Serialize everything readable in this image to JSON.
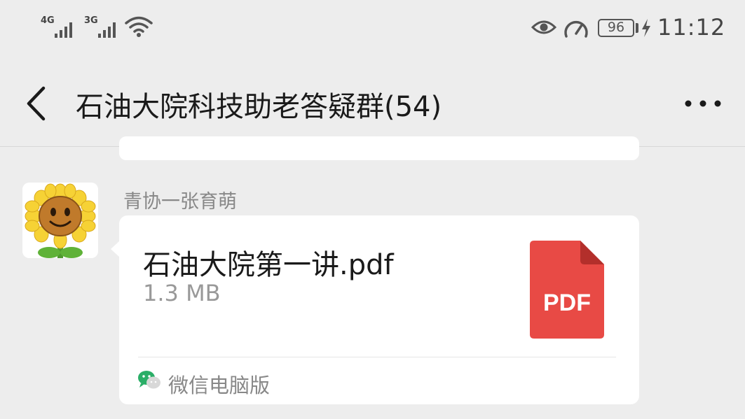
{
  "status_bar": {
    "network1": "4G",
    "network2": "3G",
    "battery_level": "96",
    "time": "11:12"
  },
  "header": {
    "title": "石油大院科技助老答疑群(54)"
  },
  "message": {
    "sender": "青协一张育萌",
    "file_name": "石油大院第一讲.pdf",
    "file_size": "1.3 MB",
    "file_type": "PDF",
    "source": "微信电脑版"
  },
  "colors": {
    "pdf_red": "#e84a45",
    "wechat_green": "#2aae67",
    "background": "#ededed"
  },
  "icons": [
    "back-icon",
    "more-icon",
    "eye-icon",
    "speed-icon",
    "battery-icon",
    "charging-icon",
    "wifi-icon",
    "signal-icon",
    "pdf-file-icon",
    "wechat-icon",
    "avatar"
  ]
}
